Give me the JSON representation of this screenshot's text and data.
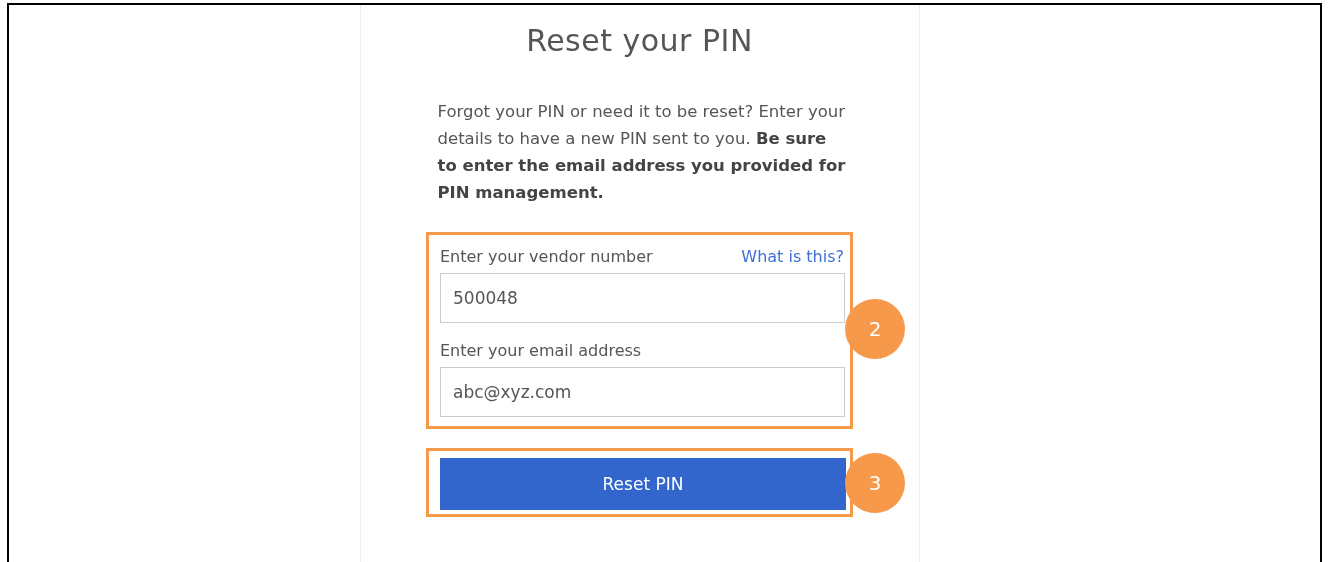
{
  "title": "Reset your PIN",
  "intro": "Forgot your PIN or need it to be reset? Enter your details to have a new PIN sent to you. **Be sure to enter the email address you provided for PIN management.**",
  "fields": [
    {
      "label": "Enter your vendor number",
      "link": "What is this?",
      "value": "500048"
    },
    {
      "label": "Enter your email address",
      "value": "abc@xyz.com"
    }
  ],
  "button": "Reset PIN",
  "callouts": [
    "2",
    "3"
  ]
}
